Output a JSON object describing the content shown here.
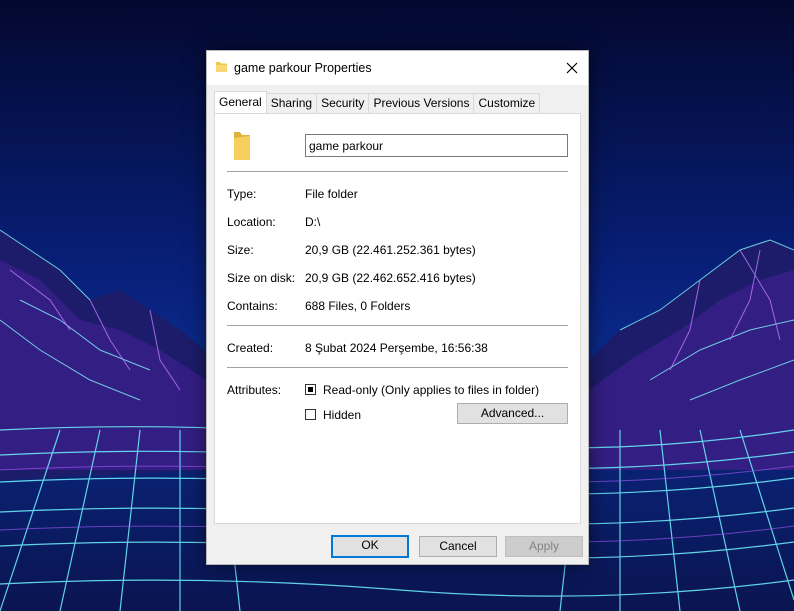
{
  "window": {
    "title": "game parkour Properties",
    "close_icon": "close-icon",
    "folder_icon": "folder-icon"
  },
  "tabs": [
    {
      "label": "General",
      "active": true
    },
    {
      "label": "Sharing",
      "active": false
    },
    {
      "label": "Security",
      "active": false
    },
    {
      "label": "Previous Versions",
      "active": false
    },
    {
      "label": "Customize",
      "active": false
    }
  ],
  "general": {
    "name_value": "game parkour",
    "fields": {
      "type_label": "Type:",
      "type_value": "File folder",
      "location_label": "Location:",
      "location_value": "D:\\",
      "size_label": "Size:",
      "size_value": "20,9 GB (22.461.252.361 bytes)",
      "size_on_disk_label": "Size on disk:",
      "size_on_disk_value": "20,9 GB (22.462.652.416 bytes)",
      "contains_label": "Contains:",
      "contains_value": "688 Files, 0 Folders",
      "created_label": "Created:",
      "created_value": "8 Şubat 2024 Perşembe, 16:56:38",
      "attributes_label": "Attributes:"
    },
    "attributes": {
      "readonly_label": "Read-only (Only applies to files in folder)",
      "readonly_state": "indeterminate",
      "hidden_label": "Hidden",
      "hidden_checked": false,
      "advanced_label": "Advanced..."
    }
  },
  "footer": {
    "ok_label": "OK",
    "cancel_label": "Cancel",
    "apply_label": "Apply"
  },
  "colors": {
    "accent": "#0078d7",
    "folder": "#f4c84f"
  }
}
